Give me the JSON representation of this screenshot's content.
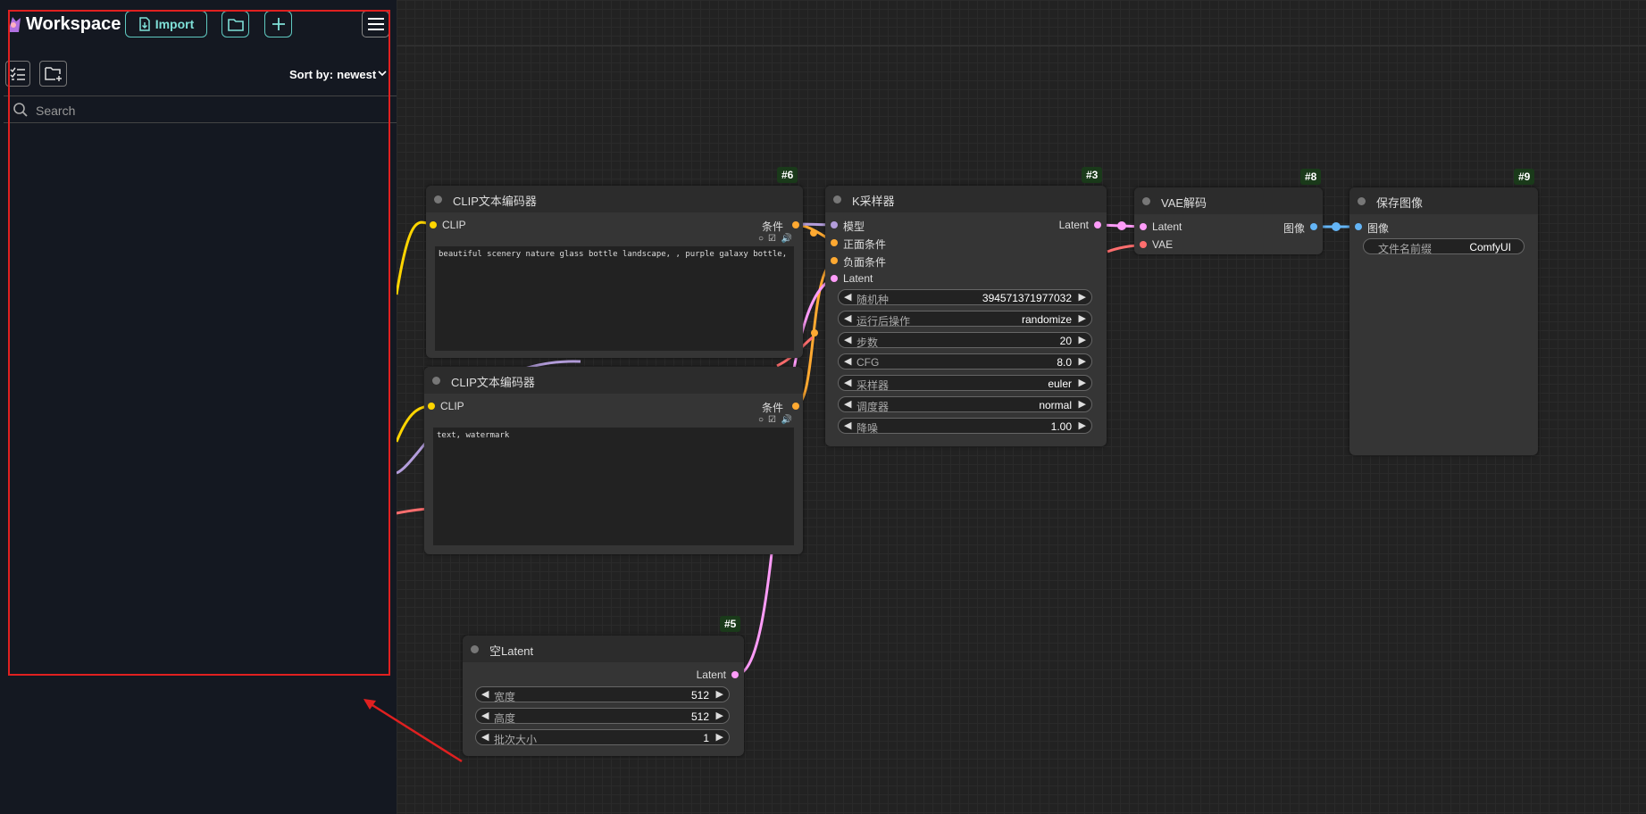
{
  "sidebar": {
    "title": "Workspace",
    "import_label": "Import",
    "sort_label": "Sort by:",
    "sort_value": "newest",
    "search_placeholder": "Search"
  },
  "nodes": {
    "clip1": {
      "badge": "#6",
      "title": "CLIP文本编码器",
      "in": "CLIP",
      "out": "条件",
      "text": "beautiful scenery nature glass bottle landscape, , purple galaxy bottle,"
    },
    "clip2": {
      "badge": "",
      "title": "CLIP文本编码器",
      "in": "CLIP",
      "out": "条件",
      "text": "text, watermark"
    },
    "ksampler": {
      "badge": "#3",
      "title": "K采样器",
      "inputs": [
        "模型",
        "正面条件",
        "负面条件",
        "Latent"
      ],
      "out": "Latent",
      "widgets": [
        {
          "label": "随机种",
          "value": "394571371977032"
        },
        {
          "label": "运行后操作",
          "value": "randomize"
        },
        {
          "label": "步数",
          "value": "20"
        },
        {
          "label": "CFG",
          "value": "8.0"
        },
        {
          "label": "采样器",
          "value": "euler"
        },
        {
          "label": "调度器",
          "value": "normal"
        },
        {
          "label": "降噪",
          "value": "1.00"
        }
      ]
    },
    "vae": {
      "badge": "#8",
      "title": "VAE解码",
      "inputs": [
        "Latent",
        "VAE"
      ],
      "out": "图像"
    },
    "save": {
      "badge": "#9",
      "title": "保存图像",
      "in": "图像",
      "widget": {
        "label": "文件名前缀",
        "value": "ComfyUI"
      }
    },
    "empty": {
      "badge": "#5",
      "title": "空Latent",
      "out": "Latent",
      "widgets": [
        {
          "label": "宽度",
          "value": "512"
        },
        {
          "label": "高度",
          "value": "512"
        },
        {
          "label": "批次大小",
          "value": "1"
        }
      ]
    }
  },
  "colors": {
    "clip": "#ffd500",
    "cond": "#ffa931",
    "model": "#b39ddb",
    "latent": "#ff9cf9",
    "vae": "#ff6e6e",
    "image": "#64b5f6",
    "accent": "#5fc8c0",
    "highlight": "#e02020"
  }
}
